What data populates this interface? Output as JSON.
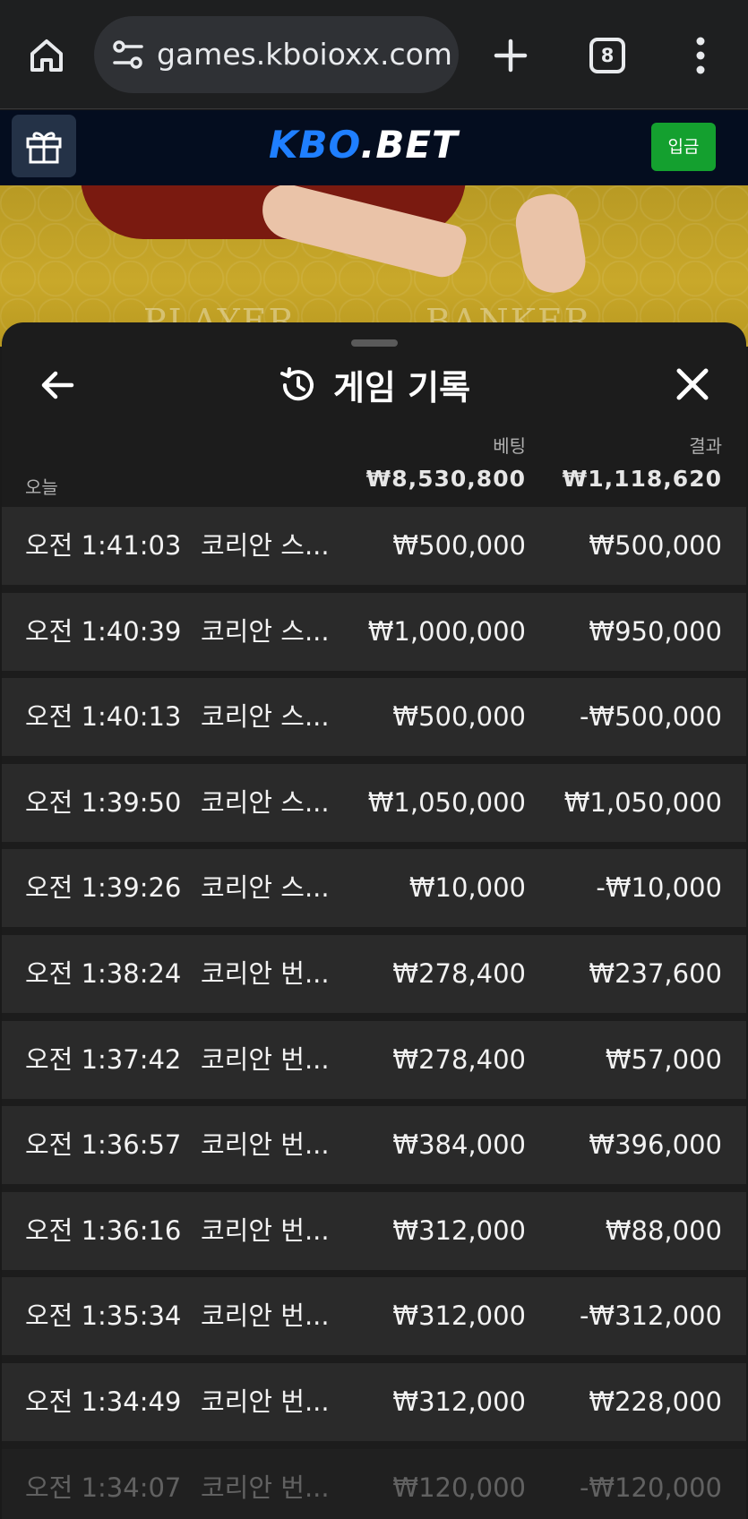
{
  "browser": {
    "url": "games.kboioxx.com/",
    "tab_count": "8"
  },
  "site": {
    "logo_main": "KBO",
    "logo_dot": ".",
    "logo_suffix": "BET",
    "deposit_label": "입금"
  },
  "table": {
    "player_label": "PLAYER",
    "banker_label": "BANKER"
  },
  "sheet": {
    "title": "게임 기록",
    "col_bet": "베팅",
    "col_result": "결과",
    "today_label": "오늘",
    "total_bet": "₩8,530,800",
    "total_result": "₩1,118,620"
  },
  "rows": [
    {
      "time": "오전 1:41:03",
      "game": "코리안 스...",
      "bet": "₩500,000",
      "result": "₩500,000"
    },
    {
      "time": "오전 1:40:39",
      "game": "코리안 스...",
      "bet": "₩1,000,000",
      "result": "₩950,000"
    },
    {
      "time": "오전 1:40:13",
      "game": "코리안 스...",
      "bet": "₩500,000",
      "result": "-₩500,000"
    },
    {
      "time": "오전 1:39:50",
      "game": "코리안 스...",
      "bet": "₩1,050,000",
      "result": "₩1,050,000"
    },
    {
      "time": "오전 1:39:26",
      "game": "코리안 스...",
      "bet": "₩10,000",
      "result": "-₩10,000"
    },
    {
      "time": "오전 1:38:24",
      "game": "코리안 번...",
      "bet": "₩278,400",
      "result": "₩237,600"
    },
    {
      "time": "오전 1:37:42",
      "game": "코리안 번...",
      "bet": "₩278,400",
      "result": "₩57,000"
    },
    {
      "time": "오전 1:36:57",
      "game": "코리안 번...",
      "bet": "₩384,000",
      "result": "₩396,000"
    },
    {
      "time": "오전 1:36:16",
      "game": "코리안 번...",
      "bet": "₩312,000",
      "result": "₩88,000"
    },
    {
      "time": "오전 1:35:34",
      "game": "코리안 번...",
      "bet": "₩312,000",
      "result": "-₩312,000"
    },
    {
      "time": "오전 1:34:49",
      "game": "코리안 번...",
      "bet": "₩312,000",
      "result": "₩228,000"
    },
    {
      "time": "오전 1:34:07",
      "game": "코리안 번...",
      "bet": "₩120,000",
      "result": "-₩120,000"
    }
  ]
}
